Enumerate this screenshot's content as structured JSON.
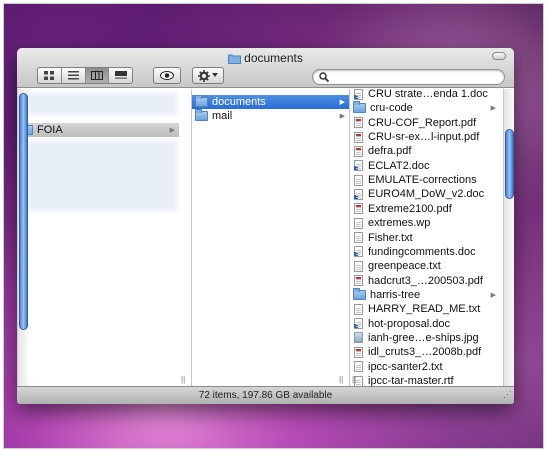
{
  "window": {
    "title": "documents",
    "status": "72 items, 197.86 GB available"
  },
  "toolbar": {
    "search_placeholder": "",
    "view_icons": [
      "icon-view-icon",
      "list-view-icon",
      "column-view-icon",
      "coverflow-view-icon"
    ]
  },
  "column1": {
    "items": [
      {
        "label": "FOIA",
        "selected": true
      }
    ]
  },
  "column2": {
    "items": [
      {
        "label": "documents",
        "selected": true,
        "folder": true
      },
      {
        "label": "mail",
        "selected": false,
        "folder": true
      }
    ]
  },
  "column3": {
    "items": [
      {
        "label": "CRU strate…enda 1.doc",
        "kind": "word"
      },
      {
        "label": "cru-code",
        "kind": "folder"
      },
      {
        "label": "CRU-COF_Report.pdf",
        "kind": "pdf"
      },
      {
        "label": "CRU-sr-ex…l-input.pdf",
        "kind": "pdf"
      },
      {
        "label": "defra.pdf",
        "kind": "pdf"
      },
      {
        "label": "ECLAT2.doc",
        "kind": "word"
      },
      {
        "label": "EMULATE-corrections",
        "kind": "doc"
      },
      {
        "label": "EURO4M_DoW_v2.doc",
        "kind": "word"
      },
      {
        "label": "Extreme2100.pdf",
        "kind": "pdf"
      },
      {
        "label": "extremes.wp",
        "kind": "doc"
      },
      {
        "label": "Fisher.txt",
        "kind": "doc"
      },
      {
        "label": "fundingcomments.doc",
        "kind": "word"
      },
      {
        "label": "greenpeace.txt",
        "kind": "doc"
      },
      {
        "label": "hadcrut3_…200503.pdf",
        "kind": "pdf"
      },
      {
        "label": "harris-tree",
        "kind": "folder"
      },
      {
        "label": "HARRY_READ_ME.txt",
        "kind": "doc"
      },
      {
        "label": "hot-proposal.doc",
        "kind": "word"
      },
      {
        "label": "ianh-gree…e-ships.jpg",
        "kind": "jpg"
      },
      {
        "label": "idl_cruts3_…2008b.pdf",
        "kind": "pdf"
      },
      {
        "label": "ipcc-santer2.txt",
        "kind": "doc"
      },
      {
        "label": "ipcc-tar-master.rtf",
        "kind": "doc"
      }
    ]
  },
  "colors": {
    "selection": "#2a6cd4",
    "folder": "#6ea4dc",
    "scroll_thumb": "#4a86d6"
  }
}
